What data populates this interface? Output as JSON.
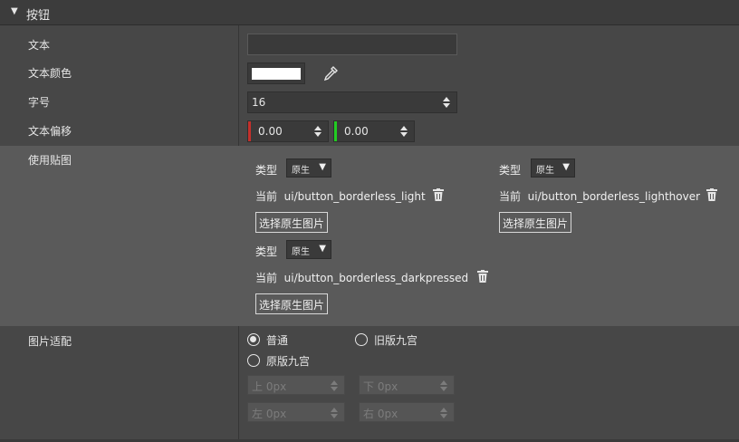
{
  "header": {
    "title": "按钮",
    "arrow_icon": "triangle-down-icon"
  },
  "text": {
    "label": "文本",
    "value": ""
  },
  "text_color": {
    "label": "文本颜色",
    "color": "#ffffff"
  },
  "font_size": {
    "label": "字号",
    "value": "16"
  },
  "text_offset": {
    "label": "文本偏移",
    "x": "0.00",
    "y": "0.00"
  },
  "use_texture": {
    "label": "使用贴图",
    "slots": [
      {
        "type_label": "类型",
        "type_value": "原生",
        "current_label": "当前",
        "path": "ui/button_borderless_light",
        "button": "选择原生图片"
      },
      {
        "type_label": "类型",
        "type_value": "原生",
        "current_label": "当前",
        "path": "ui/button_borderless_lighthover",
        "button": "选择原生图片"
      },
      {
        "type_label": "类型",
        "type_value": "原生",
        "current_label": "当前",
        "path": "ui/button_borderless_darkpressed",
        "button": "选择原生图片"
      }
    ]
  },
  "image_fit": {
    "label": "图片适配",
    "options": [
      {
        "label": "普通",
        "checked": true
      },
      {
        "label": "旧版九宫",
        "checked": false
      },
      {
        "label": "原版九宫",
        "checked": false
      }
    ],
    "top": "上 0px",
    "bottom": "下 0px",
    "left": "左 0px",
    "right": "右 0px"
  }
}
